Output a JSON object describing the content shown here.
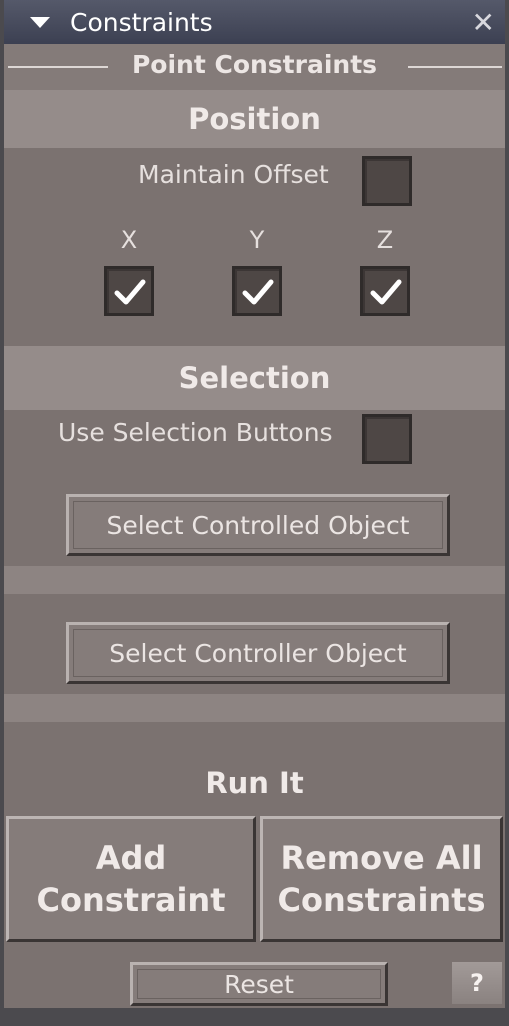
{
  "window": {
    "title": "Constraints",
    "close_glyph": "✕"
  },
  "frame": {
    "label": "Point Constraints"
  },
  "position": {
    "heading": "Position",
    "maintain_offset_label": "Maintain Offset",
    "maintain_offset_checked": false,
    "axes": [
      {
        "label": "X",
        "checked": true
      },
      {
        "label": "Y",
        "checked": true
      },
      {
        "label": "Z",
        "checked": true
      }
    ]
  },
  "selection": {
    "heading": "Selection",
    "use_buttons_label": "Use Selection Buttons",
    "use_buttons_checked": false,
    "select_controlled_label": "Select Controlled Object",
    "select_controller_label": "Select Controller Object"
  },
  "run": {
    "heading": "Run It",
    "add_label_line1": "Add",
    "add_label_line2": "Constraint",
    "remove_label_line1": "Remove All",
    "remove_label_line2": "Constraints",
    "reset_label": "Reset",
    "help_label": "?"
  },
  "icons": {
    "collapse": "triangle-down-icon",
    "close": "close-icon",
    "check": "checkmark-icon"
  }
}
